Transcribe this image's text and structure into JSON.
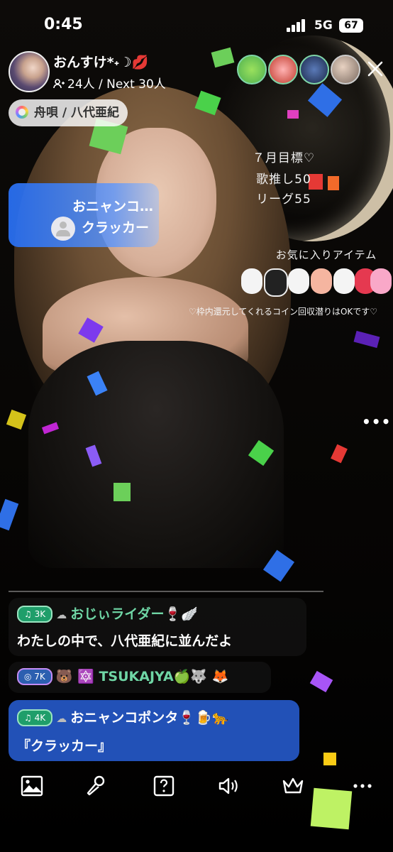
{
  "status_bar": {
    "time": "0:45",
    "network": "5G",
    "battery": "67"
  },
  "host": {
    "name": "おんすけ*˖☽💋",
    "viewers": "24人",
    "next_goal": "Next 30人",
    "viewers_line": "24人 / Next 30人"
  },
  "song": {
    "label": "舟唄 / 八代亜紀"
  },
  "gift_banner": {
    "sender": "おニャンコ…",
    "item": "クラッカー"
  },
  "overlay": {
    "goal_lines": [
      "７月目標♡",
      "歌推し50",
      "リーグ55"
    ],
    "favorites_title": "お気に入りアイテム",
    "rule_text": "♡枠内還元してくれるコイン回収潜りはOKです♡"
  },
  "comments": [
    {
      "badge": "3K",
      "user": "おじぃライダー🍷🪽",
      "message": "わたしの中で、八代亜紀に並んだよ"
    },
    {
      "badge": "7K",
      "user": "🐻 🔯 TSUKAJYA🍏🐺 🦊",
      "message": ""
    },
    {
      "badge": "4K",
      "user": "おニャンコポンタ🍷🍺🐆",
      "message": "『クラッカー』"
    }
  ],
  "colors": {
    "comment_green": "#6fd6a5",
    "banner_blue": "#2f6fe6",
    "badge_green": "#1f9e6a"
  },
  "toolbar": {
    "icons": [
      "image-icon",
      "microphone-icon",
      "question-box-icon",
      "speaker-icon",
      "crown-icon",
      "more-icon"
    ]
  }
}
